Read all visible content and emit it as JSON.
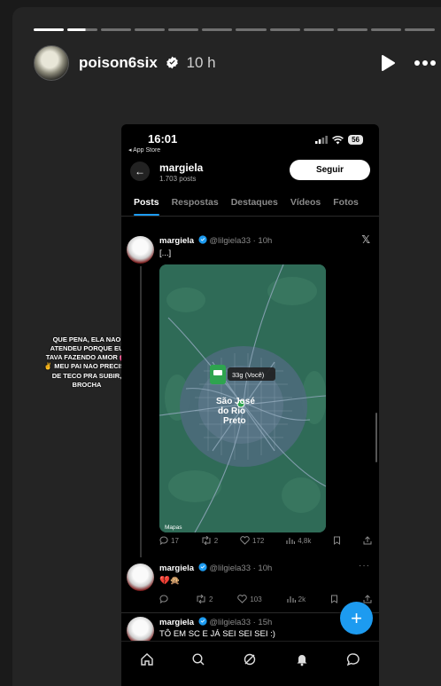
{
  "story": {
    "username": "poison6six",
    "time_ago": "10 h",
    "progress": {
      "segments": 12,
      "completed": 1,
      "current_fraction": 0.6
    },
    "overlay_text": "QUE PENA, ELA NAO ATENDEU PORQUE EU TAVA FAZENDO AMOR 💕✌️ MEU PAI NAO PRECISA DE TECO PRA SUBIR, BROCHA",
    "icons": {
      "play": "play-icon",
      "more": "more-icon",
      "verified": "verified-badge-icon"
    }
  },
  "phone": {
    "status_bar": {
      "time": "16:01",
      "back_app": "◂ App Store",
      "battery": "56"
    },
    "profile": {
      "name": "margiela",
      "posts": "1.703 posts",
      "follow_label": "Seguir"
    },
    "tabs": [
      {
        "label": "Posts",
        "active": true
      },
      {
        "label": "Respostas",
        "active": false
      },
      {
        "label": "Destaques",
        "active": false
      },
      {
        "label": "Vídeos",
        "active": false
      },
      {
        "label": "Fotos",
        "active": false
      }
    ],
    "tweets": [
      {
        "name": "margiela",
        "handle": "@lilgiela33 · 10h",
        "text": "[...]",
        "map": {
          "city": "São José do Rio Preto",
          "marker_label": "33g (Você)",
          "map_brand": "Mapas"
        },
        "stats": {
          "replies": "17",
          "retweets": "2",
          "likes": "172",
          "views": "4,8k"
        }
      },
      {
        "name": "margiela",
        "handle": "@lilgiela33 · 10h",
        "text": "💔🙊",
        "stats": {
          "replies": "",
          "retweets": "2",
          "likes": "103",
          "views": "2k"
        }
      },
      {
        "name": "margiela",
        "handle": "@lilgiela33 · 15h",
        "text": "TÔ EM SC E JÁ SEI SEI SEI :)"
      }
    ],
    "accent": "#1d9bf0"
  }
}
